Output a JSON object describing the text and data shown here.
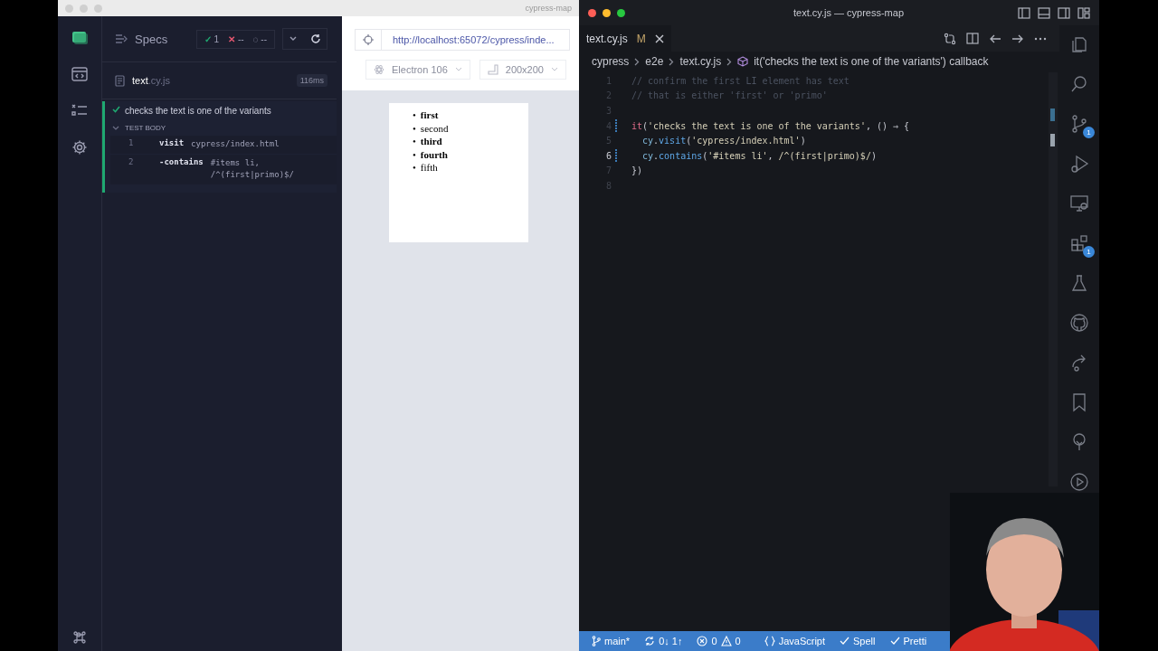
{
  "cypress_window": {
    "title": "cypress-map",
    "reporter": {
      "title": "Specs",
      "stats": [
        {
          "kind": "passed",
          "symbol": "✓",
          "count": "1"
        },
        {
          "kind": "failed",
          "symbol": "✕",
          "count": "--"
        },
        {
          "kind": "pending",
          "symbol": "◌",
          "count": "--"
        }
      ],
      "spec": {
        "name": "text",
        "extension": ".cy.js",
        "duration": "116ms"
      },
      "test": {
        "title": "checks the text is one of the variants",
        "passed": true,
        "section": "TEST BODY",
        "commands": [
          {
            "number": "1",
            "name": "visit",
            "message": "cypress/index.html"
          },
          {
            "number": "2",
            "name": "-contains",
            "message": "#items li, /^(first|primo)$/"
          }
        ]
      }
    },
    "preview": {
      "url": "http://localhost:65072/cypress/inde...",
      "browser": "Electron 106",
      "viewport": "200x200",
      "items": [
        {
          "marker": "•",
          "text": "first",
          "bold": true
        },
        {
          "marker": "•",
          "text": "second",
          "bold": false
        },
        {
          "marker": "•",
          "text": "third",
          "bold": true
        },
        {
          "marker": "•",
          "text": "fourth",
          "bold": true
        },
        {
          "marker": "•",
          "text": "fifth",
          "bold": false
        }
      ]
    }
  },
  "editor_window": {
    "title": "text.cy.js — cypress-map",
    "tab": {
      "label": "text.cy.js",
      "status": "M"
    },
    "breadcrumb": [
      "cypress",
      "e2e",
      "text.cy.js",
      "it('checks the text is one of the variants') callback"
    ],
    "lines": [
      {
        "number": "1",
        "current": false,
        "modified": false,
        "indented": false,
        "tokens": [
          {
            "kind": "comment",
            "text": "// confirm the first LI element has text"
          }
        ]
      },
      {
        "number": "2",
        "current": false,
        "modified": false,
        "indented": false,
        "tokens": [
          {
            "kind": "comment",
            "text": "// that is either 'first' or 'primo'"
          }
        ]
      },
      {
        "number": "3",
        "current": false,
        "modified": false
      },
      {
        "number": "4",
        "current": false,
        "modified": true,
        "indented": false,
        "tokens": [
          {
            "kind": "keyword",
            "text": "it"
          },
          {
            "kind": "punct",
            "text": "("
          },
          {
            "kind": "string",
            "text": "'checks the text is one of the variants'"
          },
          {
            "kind": "punct",
            "text": ", () ⇒ {"
          }
        ]
      },
      {
        "number": "5",
        "current": false,
        "modified": false,
        "indented": true,
        "tokens": [
          {
            "kind": "object",
            "text": "cy"
          },
          {
            "kind": "punct",
            "text": "."
          },
          {
            "kind": "function",
            "text": "visit"
          },
          {
            "kind": "punct",
            "text": "("
          },
          {
            "kind": "string",
            "text": "'cypress/index.html'"
          },
          {
            "kind": "punct",
            "text": ")"
          }
        ]
      },
      {
        "number": "6",
        "current": true,
        "modified": true,
        "indented": true,
        "tokens": [
          {
            "kind": "object",
            "text": "cy"
          },
          {
            "kind": "punct",
            "text": "."
          },
          {
            "kind": "function",
            "text": "contains"
          },
          {
            "kind": "punct",
            "text": "("
          },
          {
            "kind": "string",
            "text": "'#items li'"
          },
          {
            "kind": "punct",
            "text": ", "
          },
          {
            "kind": "string",
            "text": "/^(first|primo)$/"
          },
          {
            "kind": "punct",
            "text": ")"
          }
        ]
      },
      {
        "number": "7",
        "current": false,
        "modified": false,
        "indented": false,
        "tokens": [
          {
            "kind": "punct",
            "text": "})"
          }
        ]
      },
      {
        "number": "8",
        "current": false,
        "modified": false
      }
    ],
    "activity_bar": [
      {
        "kind": "files"
      },
      {
        "kind": "search"
      },
      {
        "kind": "source-control",
        "badge": "1"
      },
      {
        "kind": "debug"
      },
      {
        "kind": "remote"
      },
      {
        "kind": "extensions",
        "badge": "1"
      },
      {
        "kind": "testing"
      },
      {
        "kind": "github"
      },
      {
        "kind": "share"
      },
      {
        "kind": "bookmark"
      },
      {
        "kind": "tree"
      },
      {
        "kind": "play"
      }
    ],
    "status_bar": {
      "branch": "main*",
      "sync": "0↓ 1↑",
      "errors": "0",
      "warnings": "0",
      "language": "JavaScript",
      "spell": "Spell",
      "formatter": "Pretti"
    }
  }
}
